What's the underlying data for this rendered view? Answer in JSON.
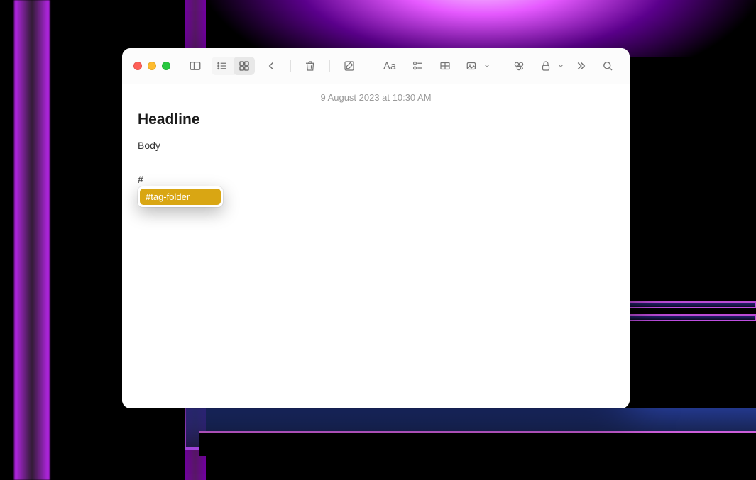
{
  "note": {
    "timestamp": "9 August 2023 at 10:30 AM",
    "headline": "Headline",
    "body": "Body",
    "hash_input": "#"
  },
  "suggestion": {
    "tag_label": "#tag-folder"
  },
  "icons": {
    "sidebar": "sidebar",
    "list_view": "list",
    "grid_view": "grid",
    "back": "back",
    "trash": "trash",
    "compose": "compose",
    "format": "Aa",
    "checklist": "checklist",
    "table": "table",
    "media": "media",
    "link": "link",
    "lock": "lock",
    "more": "more",
    "search": "search"
  },
  "colors": {
    "tag_bg": "#d9a613"
  }
}
